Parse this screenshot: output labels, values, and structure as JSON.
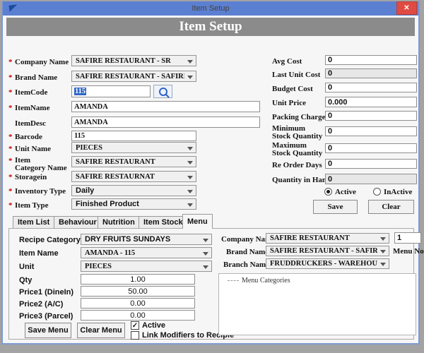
{
  "titlebar": {
    "title": "Item Setup",
    "close_label": "✕"
  },
  "header": {
    "title": "Item Setup"
  },
  "icons": {
    "check": "✓"
  },
  "form": {
    "required_marker": "*",
    "company": {
      "label": "Company Name",
      "value": "SAFIRE RESTAURANT  -  SR"
    },
    "brand": {
      "label": "Brand Name",
      "value": "SAFIRE RESTAURANT  -  SAFIRE REST"
    },
    "item_code": {
      "label": "ItemCode",
      "value": "115"
    },
    "item_name": {
      "label": "ItemName",
      "value": "AMANDA"
    },
    "item_desc": {
      "label": "ItemDesc",
      "value": "AMANDA"
    },
    "barcode": {
      "label": "Barcode",
      "value": "115"
    },
    "unit_name": {
      "label": "Unit Name",
      "value": "PIECES"
    },
    "item_category": {
      "label_line1": "Item",
      "label_line2": "Category Name",
      "value": "SAFIRE RESTAURANT"
    },
    "storagein": {
      "label": "Storagein",
      "value": "SAFIRE RESTAURNAT"
    },
    "inventory_type": {
      "label": "Inventory Type",
      "value": "Daily"
    },
    "item_type": {
      "label": "Item Type",
      "value": "Finished Product"
    },
    "avg_cost": {
      "label": "Avg Cost",
      "value": "0"
    },
    "last_unit_cost": {
      "label": "Last Unit Cost",
      "value": "0"
    },
    "budget_cost": {
      "label": "Budget Cost",
      "value": "0"
    },
    "unit_price": {
      "label": "Unit Price",
      "value": "0.000"
    },
    "packing_charge": {
      "label": "Packing Charge",
      "value": "0"
    },
    "min_stock": {
      "label_line1": "Minimum",
      "label_line2": "Stock Quantity",
      "value": "0"
    },
    "max_stock": {
      "label_line1": "Maximum",
      "label_line2": "Stock Quantity",
      "value": "0"
    },
    "reorder_days": {
      "label": "Re Order Days",
      "value": "0"
    },
    "qty_in_hand": {
      "label": "Quantity  in Han",
      "value": "0"
    },
    "radio_active": "Active",
    "radio_inactive": "InActive",
    "save_button": "Save",
    "clear_button": "Clear"
  },
  "tabs": {
    "item_list": "Item List",
    "behaviour": "Behaviour",
    "nutrition": "Nutrition",
    "item_stock": "Item Stock",
    "menu": "Menu"
  },
  "menu_panel": {
    "recipe_category": {
      "label": "Recipe Category :",
      "value": "DRY FRUITS SUNDAYS"
    },
    "item_name": {
      "label": "Item Name",
      "value": "AMANDA - 115"
    },
    "unit": {
      "label": "Unit",
      "value": "PIECES"
    },
    "qty": {
      "label": "Qty",
      "value": "1.00"
    },
    "price1": {
      "label": "Price1 (DineIn)",
      "value": "50.00"
    },
    "price2": {
      "label": "Price2 (A/C)",
      "value": "0.00"
    },
    "price3": {
      "label": "Price3 (Parcel)",
      "value": "0.00"
    },
    "save_menu_button": "Save Menu",
    "clear_menu_button": "Clear Menu",
    "active_checkbox": "Active",
    "link_modifiers_checkbox": "Link Modifiers to Recipie",
    "company": {
      "label": "Company Name",
      "value": "SAFIRE RESTAURANT"
    },
    "brand": {
      "label": "Brand Name",
      "value": "SAFIRE RESTAURANT  -  SAFIRE RES"
    },
    "branch": {
      "label": "Branch Name",
      "value": "FRUDDRUCKERS - WAREHOUSE  -  FR"
    },
    "menu_no": {
      "label": "Menu No",
      "value": "1"
    },
    "menu_categories_root": "Menu Categories"
  },
  "colors": {
    "titlebar": "#5b80d1",
    "close_button": "#df4b43",
    "header_bar": "#8b8b8b",
    "selection": "#3166c6",
    "required": "#cc0000"
  }
}
